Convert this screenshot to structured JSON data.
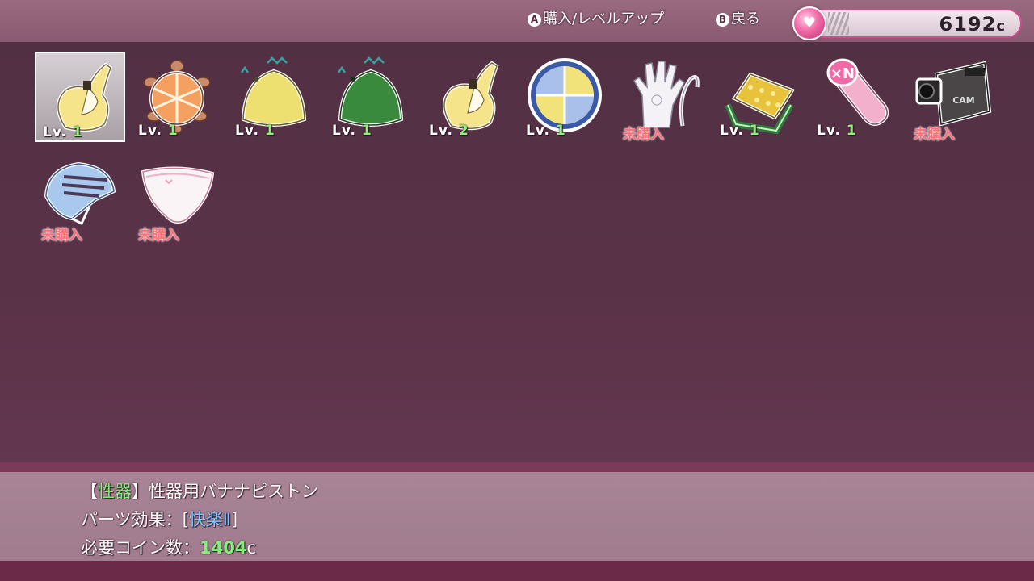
{
  "controls": {
    "a_glyph": "A",
    "a_action": "購入/レベルアップ",
    "b_glyph": "B",
    "b_action": "戻る"
  },
  "coins": {
    "value": "6192",
    "unit": "c",
    "icon": "heart-medal-icon"
  },
  "parts": [
    {
      "icon": "banana-icon",
      "level_prefix": "Lv. ",
      "level": "1",
      "selected": true
    },
    {
      "icon": "orange-turtle-icon",
      "level_prefix": "Lv. ",
      "level": "1"
    },
    {
      "icon": "yellow-cap-icon",
      "level_prefix": "Lv. ",
      "level": "1"
    },
    {
      "icon": "green-cap-icon",
      "level_prefix": "Lv. ",
      "level": "1"
    },
    {
      "icon": "banana-icon",
      "level_prefix": "Lv. ",
      "level": "2"
    },
    {
      "icon": "citrus-disc-icon",
      "level_prefix": "Lv. ",
      "level": "1"
    },
    {
      "icon": "glove-icon",
      "status": "未購入"
    },
    {
      "icon": "sponge-brush-icon",
      "level_prefix": "Lv. ",
      "level": "1"
    },
    {
      "icon": "pink-cylinder-icon",
      "level_prefix": "Lv. ",
      "level": "1"
    },
    {
      "icon": "video-camera-icon",
      "status": "未購入",
      "cam_label": "CAM"
    },
    {
      "icon": "striped-bra-icon",
      "status": "未購入"
    },
    {
      "icon": "white-panties-icon",
      "status": "未購入"
    }
  ],
  "detail": {
    "bracket_open": "【",
    "category": "性器",
    "bracket_close": "】",
    "name": "性器用バナナピストン",
    "effect_label": "パーツ効果：[",
    "effect_value": "快楽Ⅱ",
    "effect_close": "]",
    "cost_label": "必要コイン数：",
    "cost_value": "1404",
    "cost_unit": "c"
  },
  "colors": {
    "level_number": "#8ff07a",
    "unpurchased": "#ff6f78",
    "category": "#7ff07a",
    "effect": "#7ec8ff",
    "coin_frame": "#d04e8e"
  }
}
